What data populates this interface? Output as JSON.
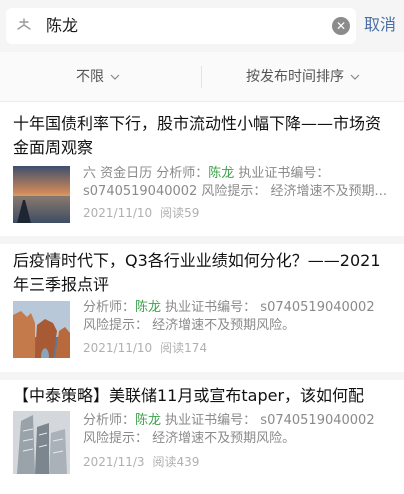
{
  "search": {
    "query": "陈龙",
    "cancel_label": "取消"
  },
  "filters": [
    {
      "label": "不限"
    },
    {
      "label": "按发布时间排序"
    }
  ],
  "articles": [
    {
      "title": "十年国债利率下行，股市流动性小幅下降——市场资金面周观察",
      "meta_line1_prefix": "六 资金日历 分析师：",
      "analyst": "陈龙",
      "meta_line1_suffix": " 执业证书编号：",
      "meta_line2": "s0740519040002 风险提示： 经济增速不及预期...",
      "date": "2021/11/10",
      "reads": "阅读59"
    },
    {
      "title": "后疫情时代下，Q3各行业业绩如何分化？——2021年三季报点评",
      "meta_line1_prefix": "分析师：",
      "analyst": "陈龙",
      "meta_line1_suffix": " 执业证书编号： s0740519040002",
      "meta_line2": "风险提示： 经济增速不及预期风险。",
      "date": "2021/11/10",
      "reads": "阅读174"
    },
    {
      "title": "【中泰策略】美联储11月或宣布taper，该如何配置？",
      "meta_line1_prefix": "分析师：",
      "analyst": "陈龙",
      "meta_line1_suffix": " 执业证书编号： s0740519040002",
      "meta_line2": "风险提示： 经济增速不及预期风险。",
      "date": "2021/11/3",
      "reads": "阅读439"
    }
  ]
}
